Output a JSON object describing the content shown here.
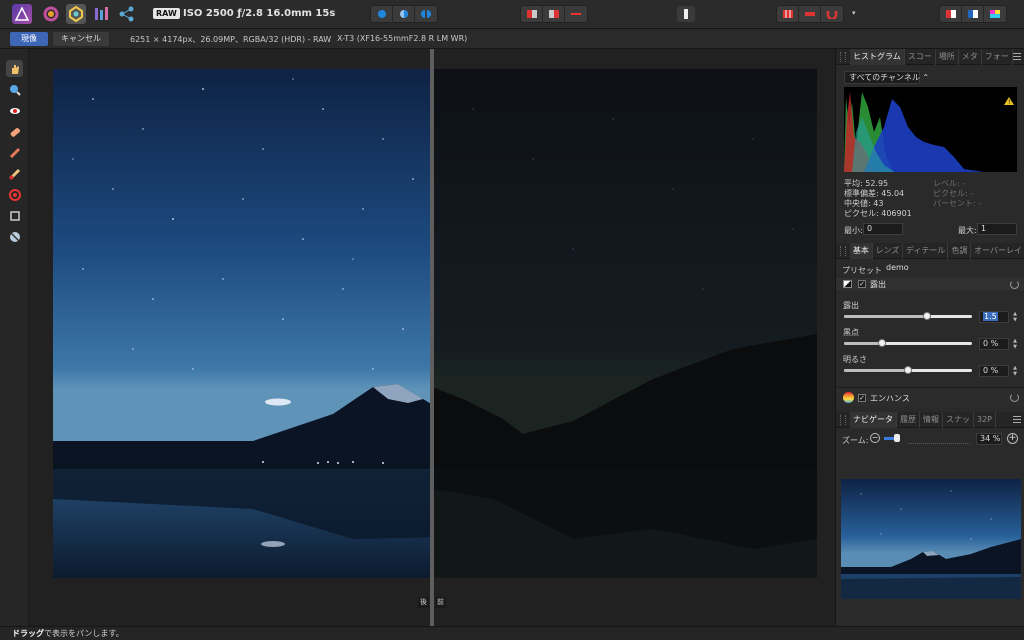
{
  "toolbar": {
    "raw_badge": "RAW",
    "exif": "ISO 2500 ƒ/2.8 16.0mm 15s",
    "personas": [
      "affinity-photo-persona-icon",
      "liquify-persona-icon",
      "develop-persona-icon",
      "tone-mapping-persona-icon",
      "export-persona-icon"
    ]
  },
  "context": {
    "develop_label": "現像",
    "cancel_label": "キャンセル",
    "image_info": "6251 × 4174px、26.09MP、RGBA/32 (HDR) - RAW",
    "camera_info": "X-T3 (XF16-55mmF2.8 R LM WR)"
  },
  "tools": [
    "view-hand-icon",
    "zoom-icon",
    "red-eye-icon",
    "blemish-icon",
    "retouch-brush-icon",
    "overlay-brush-icon",
    "white-balance-picker-icon",
    "crop-icon",
    "chromatic-aberration-icon"
  ],
  "compare": {
    "before_label": "後",
    "after_label": "前"
  },
  "histogram_panel": {
    "tabs": [
      "ヒストグラム",
      "スコー",
      "場所",
      "メタ",
      "フォー"
    ],
    "channel": "すべてのチャンネル",
    "stats": {
      "mean": "平均: 52.95",
      "stddev": "標準偏差: 45.04",
      "median": "中央値: 43",
      "pixels": "ピクセル: 406901",
      "level": "レベル: -",
      "pixel2": "ピクセル: -",
      "percent": "パーセント: -"
    },
    "min_label": "最小:",
    "min_value": "0",
    "max_label": "最大:",
    "max_value": "1"
  },
  "basic_panel": {
    "tabs": [
      "基本",
      "レンズ",
      "ディテール",
      "色調",
      "オーバーレイ"
    ],
    "preset_label": "プリセット:",
    "preset_value": "demo",
    "exposure_section": "露出",
    "sliders": [
      {
        "label": "露出",
        "value": "1.5",
        "level": 0.65
      },
      {
        "label": "黒点",
        "value": "0 %",
        "level": 0.3
      },
      {
        "label": "明るさ",
        "value": "0 %",
        "level": 0.5
      }
    ],
    "enhance_label": "エンハンス"
  },
  "navigator_panel": {
    "tabs": [
      "ナビゲータ",
      "履歴",
      "情報",
      "スナッ",
      "32P"
    ],
    "zoom_label": "ズーム:",
    "zoom_value": "34 %",
    "zoom_level": 0.15
  },
  "status": {
    "bold": "ドラッグ",
    "text": "で表示をパンします。"
  },
  "colors": {
    "accent": "#3d67b6",
    "cancel": "#3a3a3a",
    "panel_bg": "#2a2a2a"
  }
}
